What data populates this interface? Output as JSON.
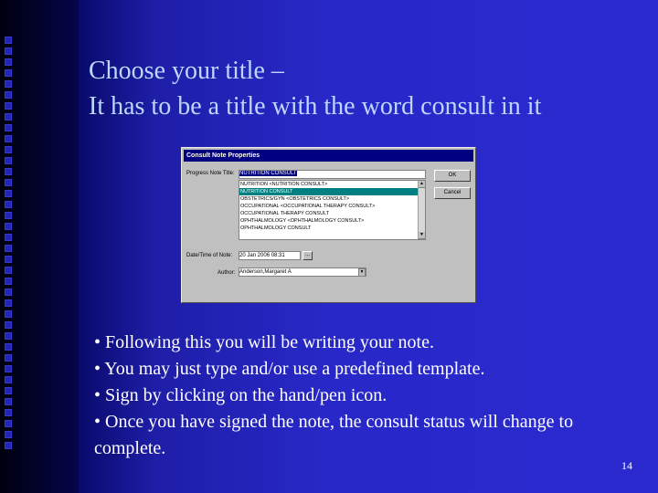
{
  "slide": {
    "title_line1": "Choose your title –",
    "title_line2": "It has to be a title with the word consult in it",
    "page_number": "14"
  },
  "dialog": {
    "title": "Consult Note Properties",
    "progress_note_title_label": "Progress Note Title:",
    "progress_note_title_value": "NUTRITION CONSULT",
    "list_items": [
      "NUTRITION <NUTRITION CONSULT>",
      "NUTRITION CONSULT",
      "OBSTETRICS/GYN <OBSTETRICS CONSULT>",
      "OCCUPATIONAL <OCCUPATIONAL THERAPY CONSULT>",
      "OCCUPATIONAL THERAPY CONSULT",
      "OPHTHALMOLOGY <OPHTHALMOLOGY CONSULT>",
      "OPHTHALMOLOGY CONSULT"
    ],
    "highlighted_index": 1,
    "ok_label": "OK",
    "cancel_label": "Cancel",
    "datetime_label": "Date/Time of Note:",
    "datetime_value": "20 Jan 2006 08:31",
    "author_label": "Author:",
    "author_value": "Anderson,Margaret A"
  },
  "bullets": [
    "• Following this you will be writing your note.",
    "• You may just type and/or use a predefined template.",
    "• Sign by clicking on the hand/pen icon.",
    "• Once you have signed the note, the consult status will change to complete."
  ]
}
